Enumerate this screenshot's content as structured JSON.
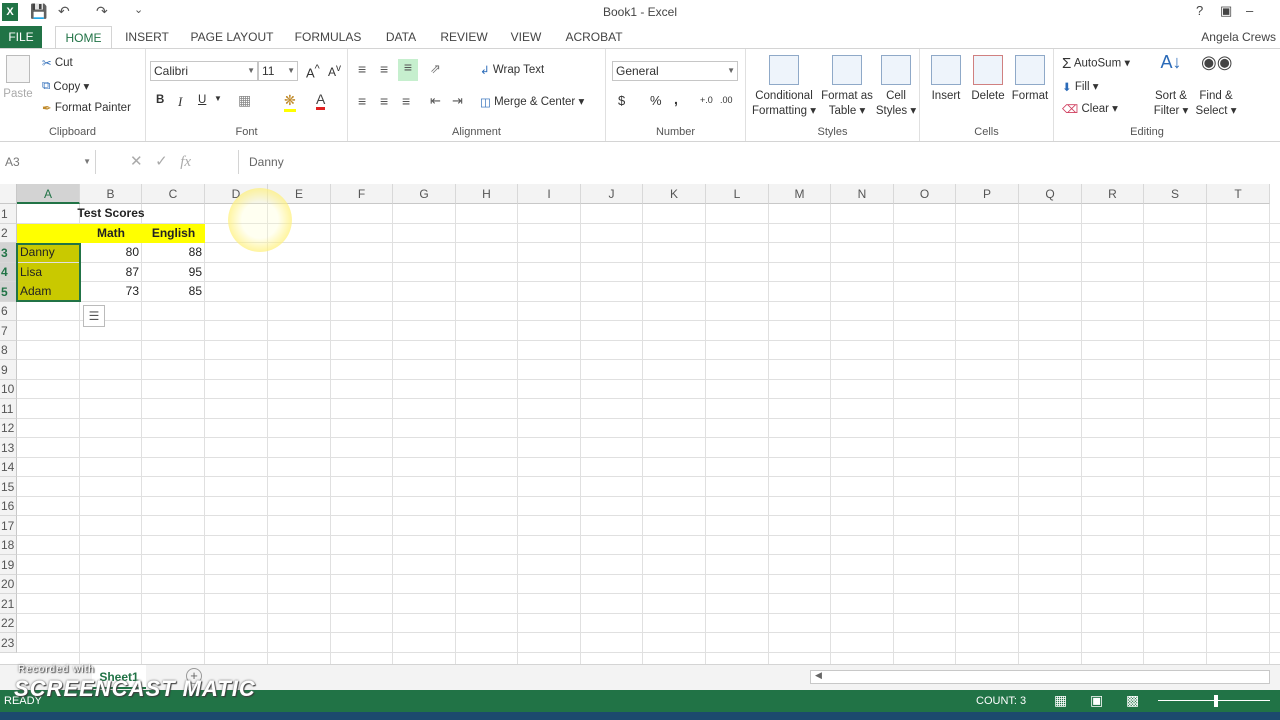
{
  "window": {
    "title": "Book1 - Excel",
    "help": "?",
    "user": "Angela Crews"
  },
  "tabs": [
    "FILE",
    "HOME",
    "INSERT",
    "PAGE LAYOUT",
    "FORMULAS",
    "DATA",
    "REVIEW",
    "VIEW",
    "ACROBAT"
  ],
  "ribbon": {
    "clipboard": {
      "paste": "Paste",
      "cut": "Cut",
      "copy": "Copy",
      "format_painter": "Format Painter",
      "label": "Clipboard"
    },
    "font": {
      "name": "Calibri",
      "size": "11",
      "bold": "B",
      "italic": "I",
      "underline": "U",
      "label": "Font"
    },
    "alignment": {
      "wrap": "Wrap Text",
      "merge": "Merge & Center",
      "label": "Alignment"
    },
    "number": {
      "format": "General",
      "currency": "$",
      "percent": "%",
      "comma": ",",
      "label": "Number"
    },
    "styles": {
      "conditional": "Conditional",
      "conditional2": "Formatting",
      "format_as": "Format as",
      "format_as2": "Table",
      "cell": "Cell",
      "cell2": "Styles",
      "label": "Styles"
    },
    "cells": {
      "insert": "Insert",
      "delete": "Delete",
      "format": "Format",
      "label": "Cells"
    },
    "editing": {
      "autosum": "AutoSum",
      "fill": "Fill",
      "clear": "Clear",
      "sort": "Sort &",
      "sort2": "Filter",
      "find": "Find &",
      "find2": "Select",
      "label": "Editing"
    }
  },
  "formula_bar": {
    "name_box": "A3",
    "value": "Danny"
  },
  "columns": [
    "A",
    "B",
    "C",
    "D",
    "E",
    "F",
    "G",
    "H",
    "I",
    "J",
    "K",
    "L",
    "M",
    "N",
    "O",
    "P",
    "Q",
    "R",
    "S",
    "T"
  ],
  "rows": [
    "1",
    "2",
    "3",
    "4",
    "5",
    "6",
    "7",
    "8",
    "9",
    "10",
    "11",
    "12",
    "13",
    "14",
    "15",
    "16",
    "17",
    "18",
    "19",
    "20",
    "21",
    "22",
    "23"
  ],
  "cells": {
    "title": "Test Scores",
    "math": "Math",
    "english": "English",
    "r3": {
      "name": "Danny",
      "math": "80",
      "english": "88"
    },
    "r4": {
      "name": "Lisa",
      "math": "87",
      "english": "95"
    },
    "r5": {
      "name": "Adam",
      "math": "73",
      "english": "85"
    }
  },
  "sheet": {
    "tab": "Sheet1",
    "add": "+"
  },
  "status": {
    "mode": "READY",
    "count": "COUNT: 3"
  },
  "watermark": {
    "top": "Recorded with",
    "brand": "SCREENCAST MATIC"
  },
  "colors": {
    "excel_green": "#217346",
    "highlight": "#ffff00"
  }
}
